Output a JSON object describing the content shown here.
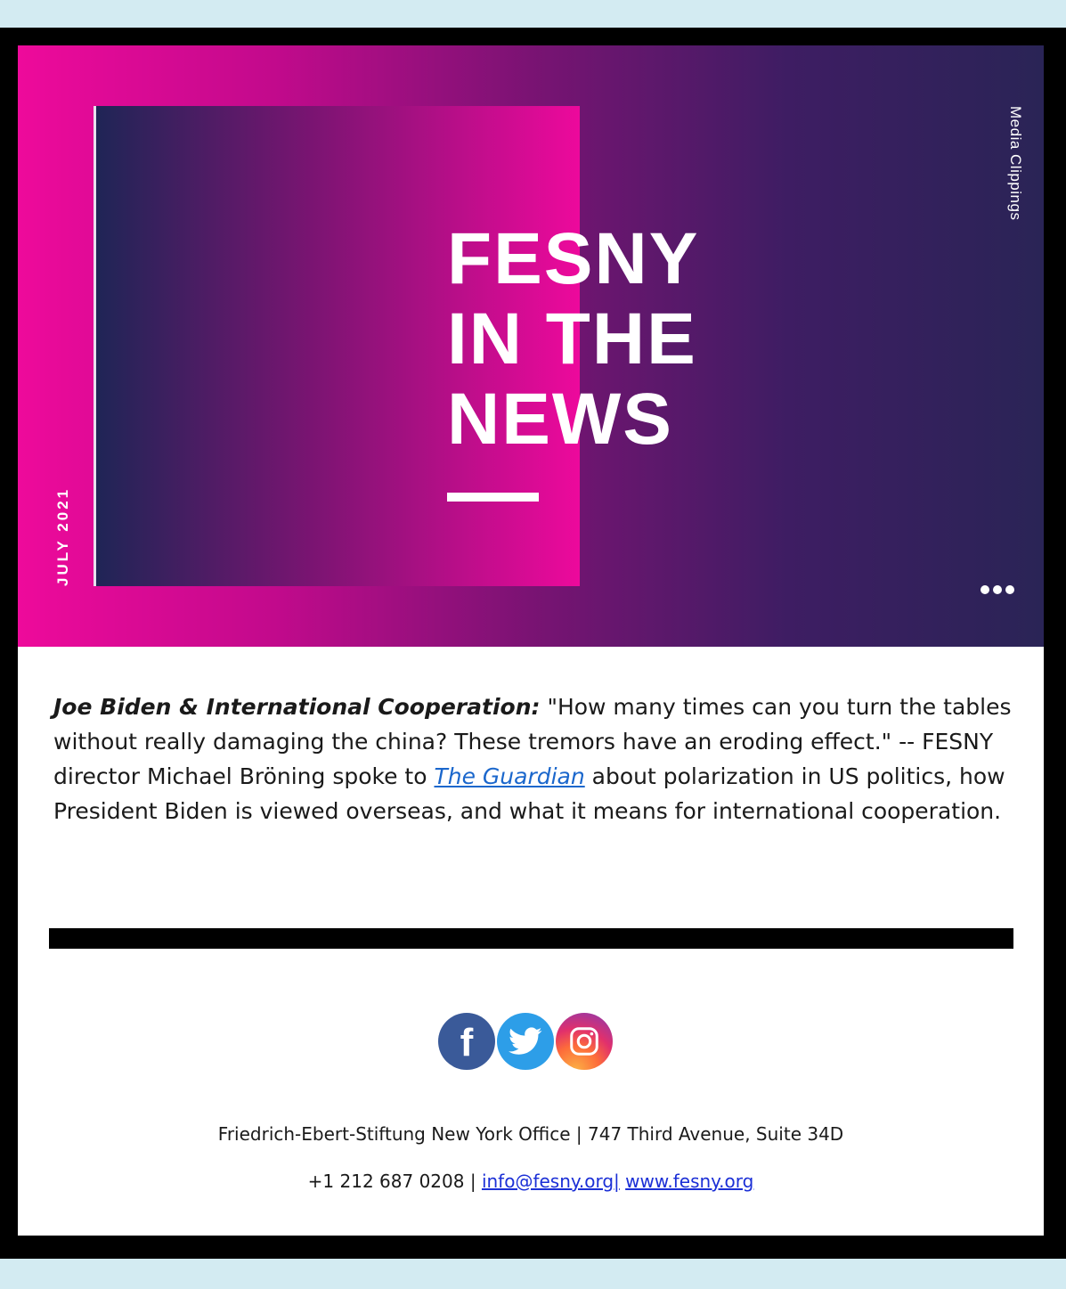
{
  "banner": {
    "headline_lines": [
      "FESNY",
      "IN THE",
      "NEWS"
    ],
    "date_label": "JULY 2021",
    "side_label": "Media Clippings"
  },
  "article": {
    "lead": "Joe Biden & International Cooperation:",
    "text_before_link": " \"How many times can you turn the tables without really damaging the china? These tremors have an eroding effect.\" -- FESNY director Michael Bröning spoke to ",
    "link_text": "The Guardian",
    "text_after_link": " about polarization in US politics, how President Biden is viewed overseas, and what it means for international cooperation."
  },
  "social": {
    "icons": [
      "facebook-icon",
      "twitter-icon",
      "instagram-icon"
    ]
  },
  "footer": {
    "address": "Friedrich-Ebert-Stiftung New York Office | 747 Third Avenue, Suite 34D",
    "phone_prefix": "+1 212 687 0208 | ",
    "email_link": "info@fesny.org|",
    "web_link": "www.fesny.org"
  },
  "colors": {
    "page_bg": "#d3ebf2",
    "frame": "#000000",
    "banner_pink": "#ee0a9b",
    "banner_navy": "#2a2456",
    "link_blue": "#1b67cc"
  }
}
